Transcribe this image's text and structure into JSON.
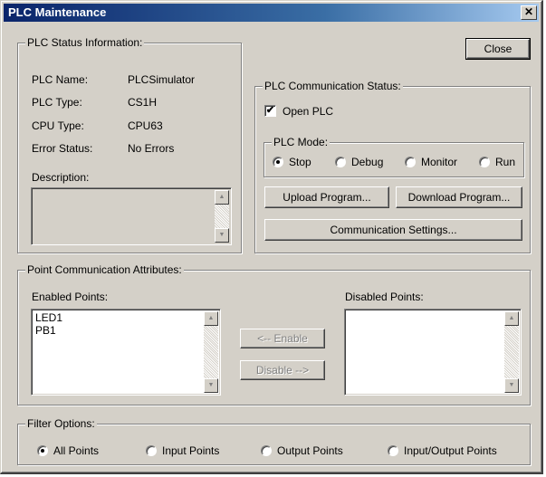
{
  "window": {
    "title": "PLC Maintenance",
    "close_glyph": "✕"
  },
  "close_button": {
    "label": "Close"
  },
  "status_info": {
    "title": "PLC Status Information:",
    "rows": [
      {
        "label": "PLC Name:",
        "value": "PLCSimulator"
      },
      {
        "label": "PLC Type:",
        "value": "CS1H"
      },
      {
        "label": "CPU Type:",
        "value": "CPU63"
      },
      {
        "label": "Error Status:",
        "value": "No Errors"
      }
    ],
    "description_label": "Description:",
    "description_value": ""
  },
  "comm_status": {
    "title": "PLC Communication Status:",
    "open_plc": {
      "label": "Open PLC",
      "checked": true,
      "mark": "✔"
    },
    "mode": {
      "title": "PLC Mode:",
      "options": [
        {
          "label": "Stop",
          "checked": true
        },
        {
          "label": "Debug",
          "checked": false
        },
        {
          "label": "Monitor",
          "checked": false
        },
        {
          "label": "Run",
          "checked": false
        }
      ]
    },
    "upload_label": "Upload Program...",
    "download_label": "Download Program...",
    "settings_label": "Communication Settings..."
  },
  "points": {
    "title": "Point Communication Attributes:",
    "enabled_label": "Enabled Points:",
    "enabled_items": [
      "LED1",
      "PB1"
    ],
    "disabled_label": "Disabled Points:",
    "disabled_items": [],
    "enable_button": "<-- Enable",
    "disable_button": "Disable -->"
  },
  "filter": {
    "title": "Filter Options:",
    "options": [
      {
        "label": "All Points",
        "checked": true
      },
      {
        "label": "Input Points",
        "checked": false
      },
      {
        "label": "Output Points",
        "checked": false
      },
      {
        "label": "Input/Output Points",
        "checked": false
      }
    ]
  },
  "icons": {
    "scroll_up": "▲",
    "scroll_down": "▼"
  },
  "colors": {
    "face": "#d4d0c8",
    "titlebar_start": "#0a246a",
    "titlebar_end": "#a6caf0"
  }
}
